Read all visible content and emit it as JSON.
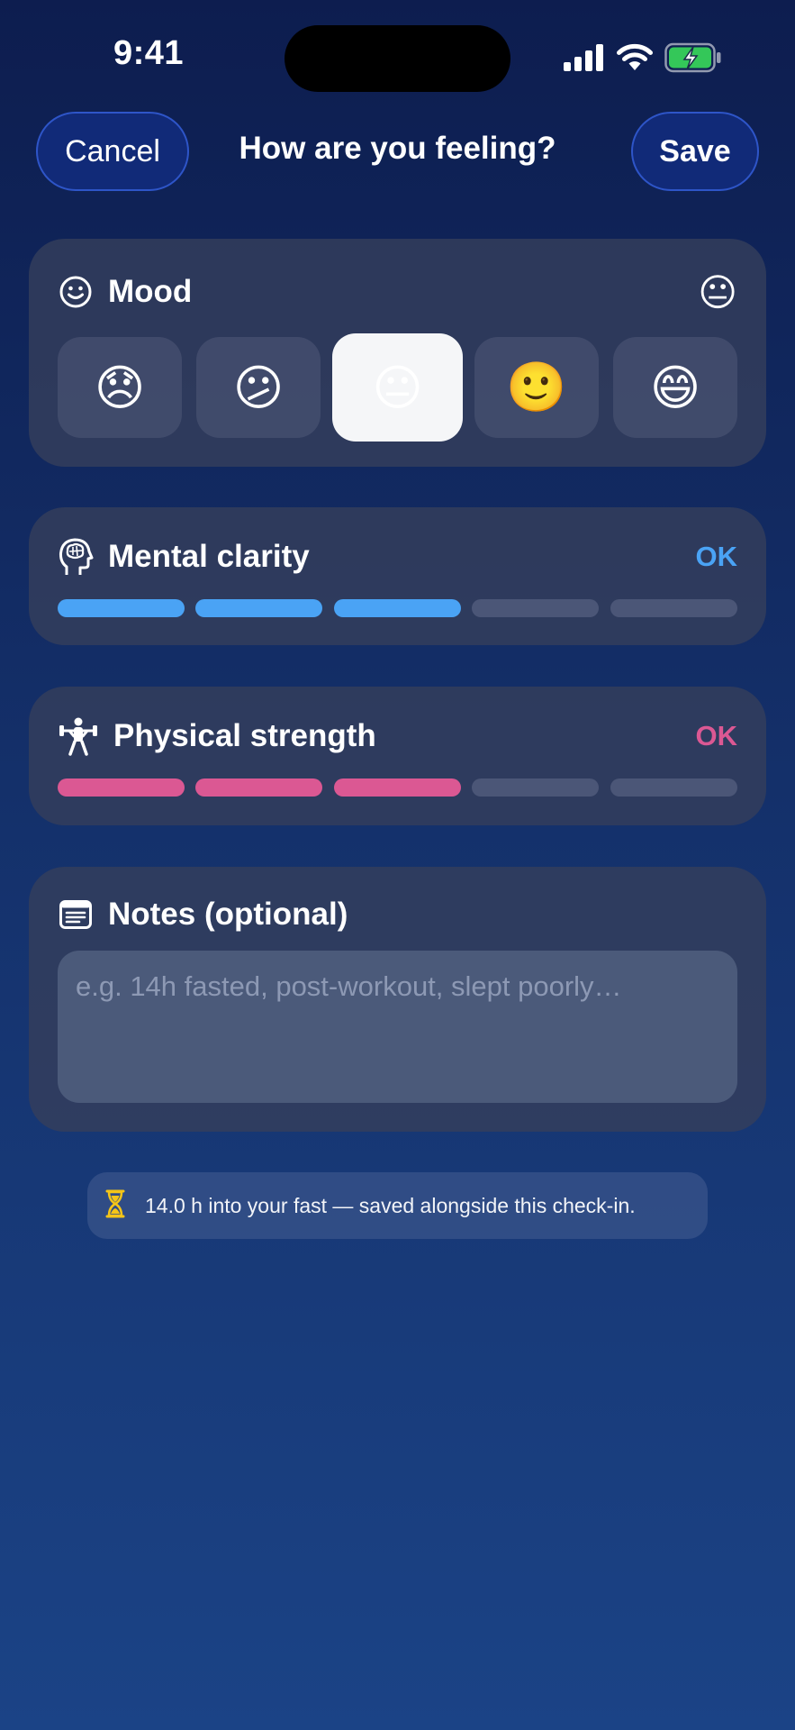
{
  "status_bar": {
    "time": "9:41"
  },
  "nav": {
    "cancel_label": "Cancel",
    "title": "How are you feeling?",
    "save_label": "Save"
  },
  "mood": {
    "title": "Mood",
    "current_emoji": "😐",
    "options": [
      "😞",
      "😕",
      "😐",
      "🙂",
      "😄"
    ],
    "selected_index": 2
  },
  "mental_clarity": {
    "title": "Mental clarity",
    "value_label": "OK",
    "level": 3,
    "max_level": 5,
    "accent_color": "#4aa3f5"
  },
  "physical_strength": {
    "title": "Physical strength",
    "value_label": "OK",
    "level": 3,
    "max_level": 5,
    "accent_color": "#db5893"
  },
  "notes": {
    "title": "Notes (optional)",
    "placeholder": "e.g. 14h fasted, post-workout, slept poorly…",
    "value": ""
  },
  "fast_banner": {
    "icon": "hourglass-icon",
    "text": "14.0 h into your fast — saved alongside this check-in."
  }
}
